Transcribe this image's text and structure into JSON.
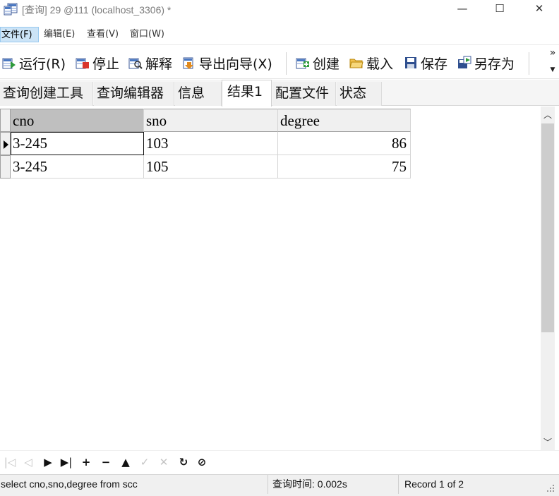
{
  "window": {
    "title": "[查询] 29 @111 (localhost_3306) *",
    "icon": "query-window-icon",
    "controls": {
      "minimize": "—",
      "maximize": "☐",
      "close": "✕"
    }
  },
  "menu": {
    "file": "文件(F)",
    "edit": "编辑(E)",
    "view": "查看(V)",
    "window": "窗口(W)"
  },
  "toolbar": {
    "run": {
      "label": "运行(R)",
      "icon": "run-icon"
    },
    "stop": {
      "label": "停止",
      "icon": "stop-icon"
    },
    "explain": {
      "label": "解释",
      "icon": "explain-icon"
    },
    "export": {
      "label": "导出向导(X)",
      "icon": "export-wizard-icon"
    },
    "create": {
      "label": "创建",
      "icon": "create-icon"
    },
    "load": {
      "label": "载入",
      "icon": "folder-icon"
    },
    "save": {
      "label": "保存",
      "icon": "save-icon"
    },
    "saveas": {
      "label": "另存为",
      "icon": "save-as-icon"
    },
    "more": "»"
  },
  "tabs": [
    {
      "label": "查询创建工具"
    },
    {
      "label": "查询编辑器"
    },
    {
      "label": "信息"
    },
    {
      "label": "结果1",
      "active": true
    },
    {
      "label": "配置文件"
    },
    {
      "label": "状态"
    }
  ],
  "grid": {
    "columns": [
      "cno",
      "sno",
      "degree"
    ],
    "rows": [
      [
        "3-245",
        "103",
        "86"
      ],
      [
        "3-245",
        "105",
        "75"
      ]
    ],
    "current_row": 1
  },
  "navigator": {
    "first": "|◁",
    "prior": "◁",
    "next": "▶",
    "last": "▶|",
    "insert": "+",
    "delete": "−",
    "edit": "▲",
    "post": "✓",
    "cancel": "✕",
    "refresh": "↻",
    "stop": "⊘"
  },
  "status": {
    "sql": "select cno,sno,degree from scc",
    "time": "查询时间: 0.002s",
    "record": "Record 1 of 2"
  },
  "colors": {
    "menu_highlight": "#cce4f7",
    "header_bg": "#f0f0f0",
    "sorted_header_bg": "#bfbfbf",
    "statusbar_bg": "#f0f0f0"
  }
}
